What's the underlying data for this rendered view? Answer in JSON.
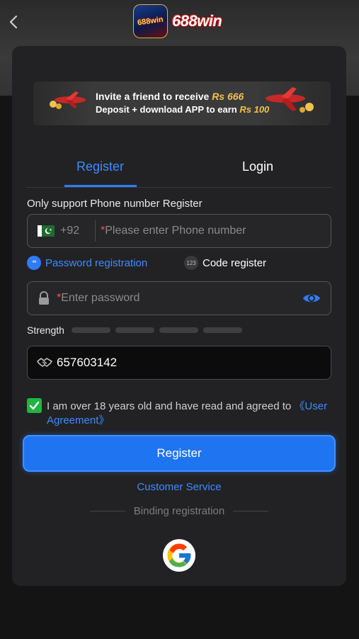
{
  "header": {
    "logo_icon_text": "688win",
    "logo_text": "688win"
  },
  "banner": {
    "line1_prefix": "Invite a friend to receive",
    "line1_amount": "Rs 666",
    "line2_prefix": "Deposit + download APP to earn",
    "line2_amount": "Rs 100"
  },
  "tabs": [
    {
      "label": "Register",
      "active": true
    },
    {
      "label": "Login",
      "active": false
    }
  ],
  "form": {
    "support_label": "Only support Phone number Register",
    "phone": {
      "country_code": "+92",
      "required_mark": "*",
      "placeholder": "Please enter Phone number"
    },
    "modes": {
      "password_icon": "**",
      "password_label": "Password registration",
      "code_icon": "123",
      "code_label": "Code register"
    },
    "password": {
      "required_mark": "*",
      "placeholder": "Enter password"
    },
    "strength_label": "Strength",
    "referral_value": "657603142",
    "agreement": {
      "text": "I am over 18 years old and have read and agreed to ",
      "link": "《User Agreement》",
      "checked": true
    },
    "register_button": "Register"
  },
  "footer": {
    "customer_service": "Customer Service",
    "binding_label": "Binding registration"
  },
  "colors": {
    "accent": "#2f7cf6",
    "checkbox": "#1fb541",
    "card": "#222224",
    "background": "#141414"
  }
}
